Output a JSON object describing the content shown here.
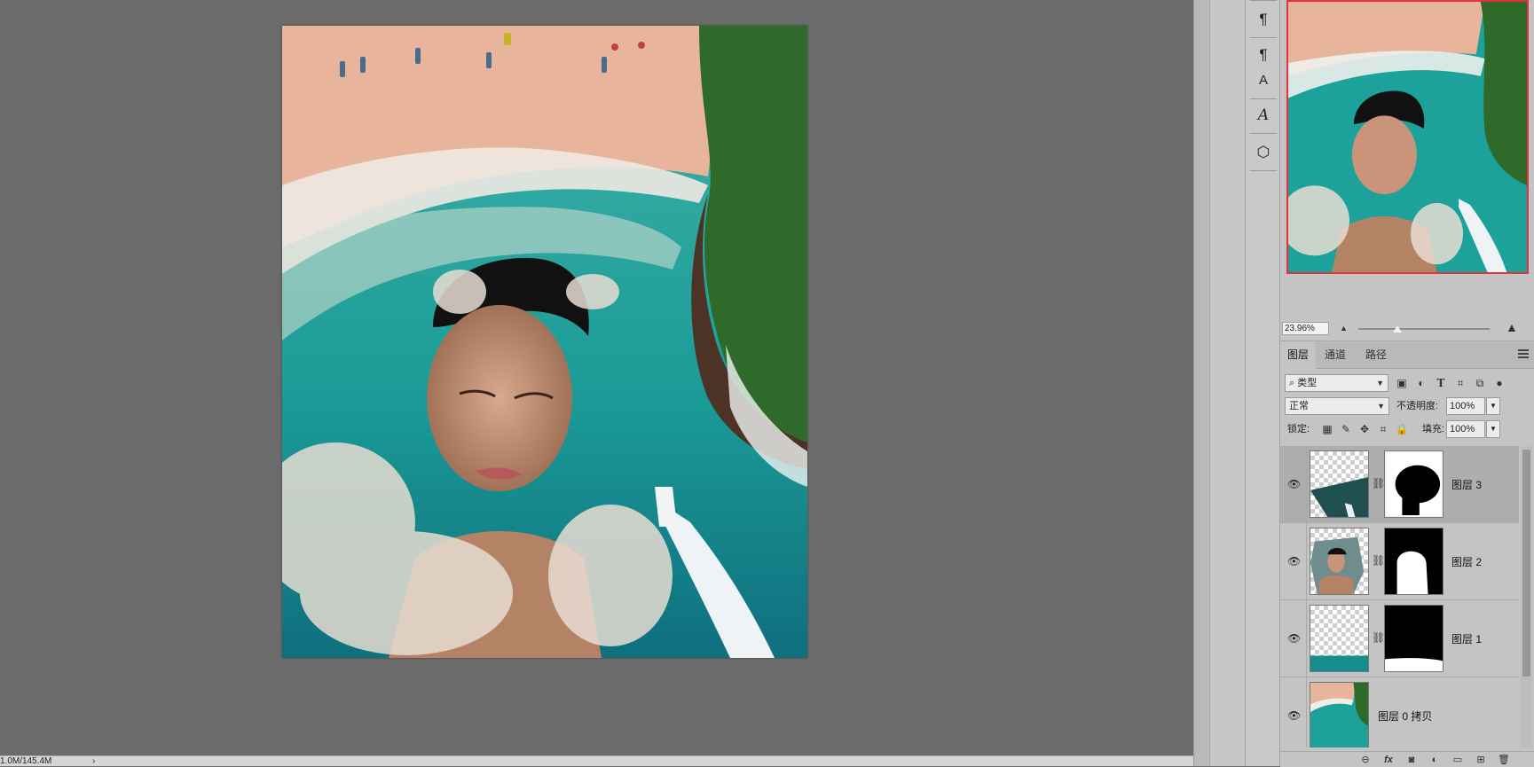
{
  "status_bar": {
    "doc_size": "1.0M/145.4M",
    "arrow": "›"
  },
  "tool_strip": {
    "icons": [
      "paragraph-icon",
      "paragraph-style-icon",
      "character-style-icon",
      "glyphs-icon",
      "3d-cube-icon"
    ],
    "glyphs": [
      "¶",
      "¶",
      "A",
      "A",
      "⬡"
    ]
  },
  "navigator": {
    "zoom": "23.96%",
    "zoom_level": 0.3
  },
  "layers_panel": {
    "tabs": [
      {
        "label": "图层",
        "active": true
      },
      {
        "label": "通道",
        "active": false
      },
      {
        "label": "路径",
        "active": false
      }
    ],
    "filter": {
      "kind": "类型",
      "search_glyph": "⌕"
    },
    "blend_mode": "正常",
    "opacity_label": "不透明度:",
    "opacity": "100%",
    "lock_label": "锁定:",
    "fill_label": "填充:",
    "fill": "100%",
    "layers": [
      {
        "name": "图层 3",
        "selected": true,
        "has_mask": true
      },
      {
        "name": "图层 2",
        "selected": false,
        "has_mask": true
      },
      {
        "name": "图层 1",
        "selected": false,
        "has_mask": true
      },
      {
        "name": "图层 0 拷贝",
        "selected": false,
        "has_mask": false
      }
    ],
    "footer_icons": [
      "link-layers-icon",
      "fx-icon",
      "add-mask-icon",
      "adjustment-layer-icon",
      "new-group-icon",
      "new-layer-icon",
      "delete-layer-icon"
    ],
    "footer_glyphs": [
      "⊖",
      "fx",
      "◙",
      "◐",
      "▭",
      "⊞",
      "🗑"
    ]
  },
  "colors": {
    "selection_border": "#e0343a",
    "workspace": "#6b6b6b",
    "panel": "#c4c4c4"
  }
}
